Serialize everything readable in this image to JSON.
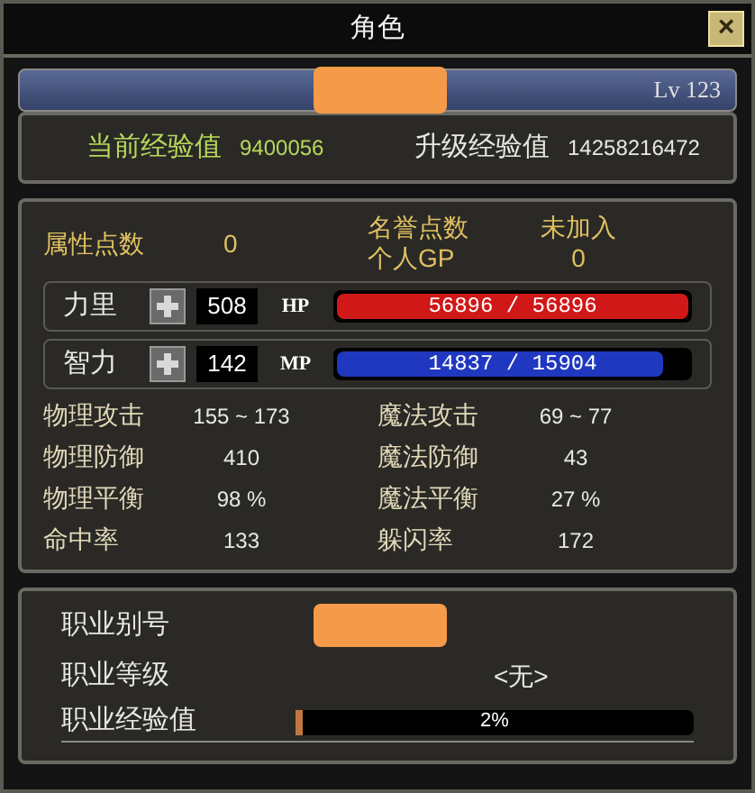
{
  "window": {
    "title": "角色",
    "close": "×"
  },
  "name_bar": {
    "level": "Lv 123"
  },
  "experience": [
    {
      "label": "当前经验值",
      "value": "9400056",
      "kind": "green"
    },
    {
      "label": "升级经验值",
      "value": "14258216472",
      "kind": "white"
    }
  ],
  "points": {
    "label": "属性点数",
    "value": "0",
    "honor_label": "名誉点数",
    "honor_value": "未加入",
    "gp_label": "个人GP",
    "gp_value": "0"
  },
  "attributes": [
    {
      "label": "力里",
      "value": "508",
      "bar_label": "HP",
      "bar_text": "56896 / 56896",
      "level": 1.0,
      "color": "#d01818"
    },
    {
      "label": "智力",
      "value": "142",
      "bar_label": "MP",
      "bar_text": "14837 / 15904",
      "level": 0.93,
      "color": "#2038c0"
    }
  ],
  "stats": [
    {
      "label": "物理攻击",
      "value": "155 ~ 173"
    },
    {
      "label": "魔法攻击",
      "value": "69 ~ 77"
    },
    {
      "label": "物理防御",
      "value": "410"
    },
    {
      "label": "魔法防御",
      "value": "43"
    },
    {
      "label": "物理平衡",
      "value": "98 %"
    },
    {
      "label": "魔法平衡",
      "value": "27 %"
    },
    {
      "label": "命中率",
      "value": "133"
    },
    {
      "label": "躲闪率",
      "value": "172"
    }
  ],
  "job": {
    "alias_label": "职业别号",
    "grade_label": "职业等级",
    "grade_value": "<无>",
    "exp_label": "职业经验值",
    "exp_text": "2%",
    "level": 0.02
  }
}
